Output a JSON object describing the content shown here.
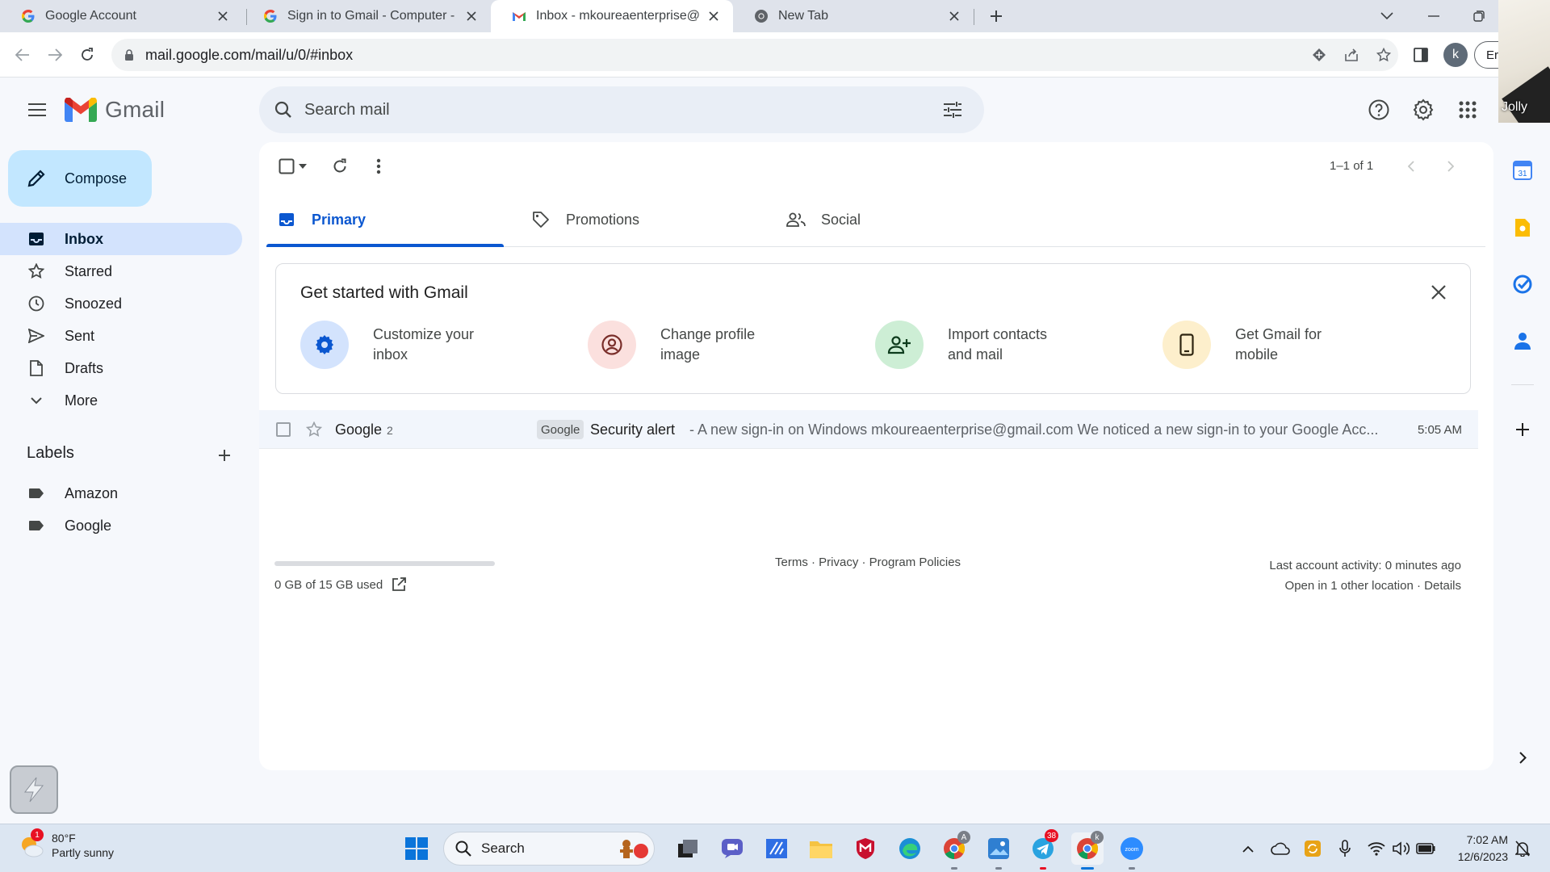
{
  "browser": {
    "tabs": [
      {
        "title": "Google Account",
        "icon": "google-g-icon"
      },
      {
        "title": "Sign in to Gmail - Computer - G",
        "icon": "google-g-icon"
      },
      {
        "title": "Inbox - mkoureaenterprise@gm",
        "icon": "gmail-icon",
        "active": true
      },
      {
        "title": "New Tab",
        "icon": "chrome-icon"
      }
    ],
    "url": "mail.google.com/mail/u/0/#inbox",
    "profile_initial": "k",
    "extension_chip": "Err",
    "camera_name": "Jolly"
  },
  "gmail": {
    "logo_text": "Gmail",
    "search_placeholder": "Search mail",
    "compose_label": "Compose",
    "nav": [
      {
        "label": "Inbox",
        "icon": "inbox-icon",
        "active": true
      },
      {
        "label": "Starred",
        "icon": "star-icon"
      },
      {
        "label": "Snoozed",
        "icon": "clock-icon"
      },
      {
        "label": "Sent",
        "icon": "send-icon"
      },
      {
        "label": "Drafts",
        "icon": "draft-icon"
      },
      {
        "label": "More",
        "icon": "chevron-down-icon"
      }
    ],
    "labels_title": "Labels",
    "labels": [
      {
        "label": "Amazon",
        "icon": "label-icon"
      },
      {
        "label": "Google",
        "icon": "label-icon"
      }
    ],
    "pager": "1–1 of 1",
    "categories": [
      {
        "label": "Primary",
        "icon": "inbox-tray-icon",
        "active": true
      },
      {
        "label": "Promotions",
        "icon": "tag-icon"
      },
      {
        "label": "Social",
        "icon": "people-icon"
      }
    ],
    "get_started": {
      "title": "Get started with Gmail",
      "items": [
        {
          "line1": "Customize your",
          "line2": "inbox",
          "icon": "gear-icon",
          "color": "#d3e3fd"
        },
        {
          "line1": "Change profile",
          "line2": "image",
          "icon": "account-circle-icon",
          "color": "#fbe0de"
        },
        {
          "line1": "Import contacts",
          "line2": "and mail",
          "icon": "person-add-icon",
          "color": "#cdeed5"
        },
        {
          "line1": "Get Gmail for",
          "line2": "mobile",
          "icon": "phone-icon",
          "color": "#fdefcc"
        }
      ]
    },
    "emails": [
      {
        "sender": "Google",
        "count": "2",
        "label_chip": "Google",
        "subject": "Security alert",
        "snippet": " - A new sign-in on Windows mkoureaenterprise@gmail.com We noticed a new sign-in to your Google Acc...",
        "time": "5:05 AM"
      }
    ],
    "footer": {
      "storage": "0 GB of 15 GB used",
      "storage_fraction": 0.0,
      "links": "Terms · Privacy · Program Policies",
      "activity_line1": "Last account activity: 0 minutes ago",
      "activity_line2": "Open in 1 other location · Details"
    }
  },
  "taskbar": {
    "weather_temp": "80°F",
    "weather_desc": "Partly sunny",
    "weather_badge": "1",
    "search_label": "Search",
    "telegram_badge": "38",
    "time": "7:02 AM",
    "date": "12/6/2023"
  }
}
